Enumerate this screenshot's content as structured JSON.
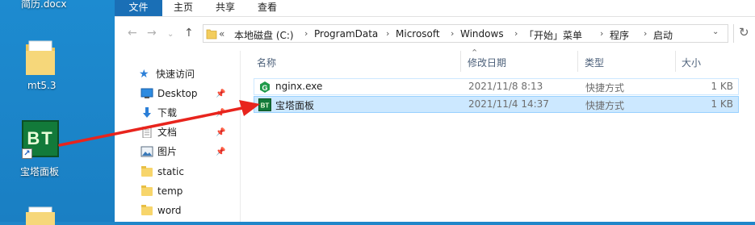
{
  "desktop": {
    "top_file": "简历.docx",
    "folder_label": "mt5.3",
    "app_label": "宝塔面板",
    "app_icon_text": "BT"
  },
  "ribbon": {
    "tabs": [
      "文件",
      "主页",
      "共享",
      "查看"
    ]
  },
  "address": {
    "prefix": "«",
    "crumbs": [
      "本地磁盘 (C:)",
      "ProgramData",
      "Microsoft",
      "Windows",
      "「开始」菜单",
      "程序",
      "启动"
    ]
  },
  "nav": {
    "items": [
      {
        "label": "快速访问",
        "icon": "star-icon"
      },
      {
        "label": "Desktop",
        "icon": "desktop-icon",
        "pinned": true
      },
      {
        "label": "下载",
        "icon": "download-icon",
        "pinned": true
      },
      {
        "label": "文档",
        "icon": "document-icon",
        "pinned": true
      },
      {
        "label": "图片",
        "icon": "picture-icon",
        "pinned": true
      },
      {
        "label": "static",
        "icon": "folder-icon"
      },
      {
        "label": "temp",
        "icon": "folder-icon"
      },
      {
        "label": "word",
        "icon": "folder-icon"
      }
    ]
  },
  "columns": {
    "name": "名称",
    "date": "修改日期",
    "type": "类型",
    "size": "大小"
  },
  "files": [
    {
      "name": "nginx.exe",
      "date": "2021/11/8 8:13",
      "type": "快捷方式",
      "size": "1 KB"
    },
    {
      "name": "宝塔面板",
      "date": "2021/11/4 14:37",
      "type": "快捷方式",
      "size": "1 KB"
    }
  ],
  "colors": {
    "accent": "#1a6fb6",
    "selection": "#cce8ff",
    "arrow": "#e8241d",
    "desktop_bg": "#1a7fc3"
  }
}
